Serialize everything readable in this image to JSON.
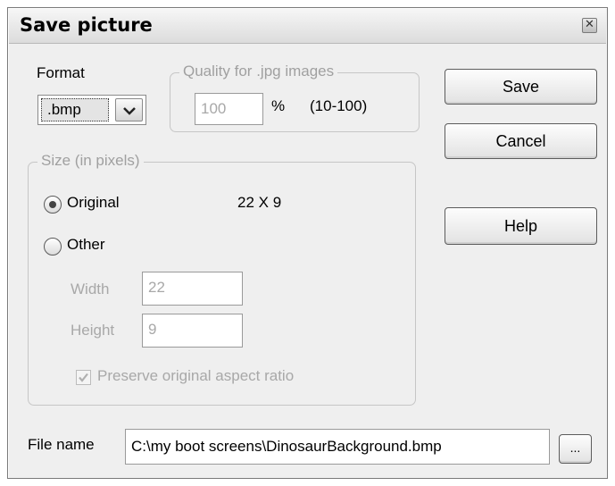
{
  "dialog": {
    "title": "Save picture",
    "close_glyph": "✕"
  },
  "format": {
    "label": "Format",
    "selected": ".bmp",
    "dropdown_icon": "chevron-down-icon"
  },
  "quality": {
    "group_label": "Quality for .jpg images",
    "value": "100",
    "unit": "%",
    "range": "(10-100)"
  },
  "size": {
    "group_label": "Size (in pixels)",
    "original_label": "Original",
    "original_dims": "22 X 9",
    "original_selected": true,
    "other_label": "Other",
    "width_label": "Width",
    "width_value": "22",
    "height_label": "Height",
    "height_value": "9",
    "preserve_label": "Preserve original aspect ratio",
    "preserve_checked": true
  },
  "buttons": {
    "save": "Save",
    "cancel": "Cancel",
    "help": "Help",
    "browse": "..."
  },
  "file": {
    "label": "File name",
    "value": "C:\\my boot screens\\DinosaurBackground.bmp"
  }
}
